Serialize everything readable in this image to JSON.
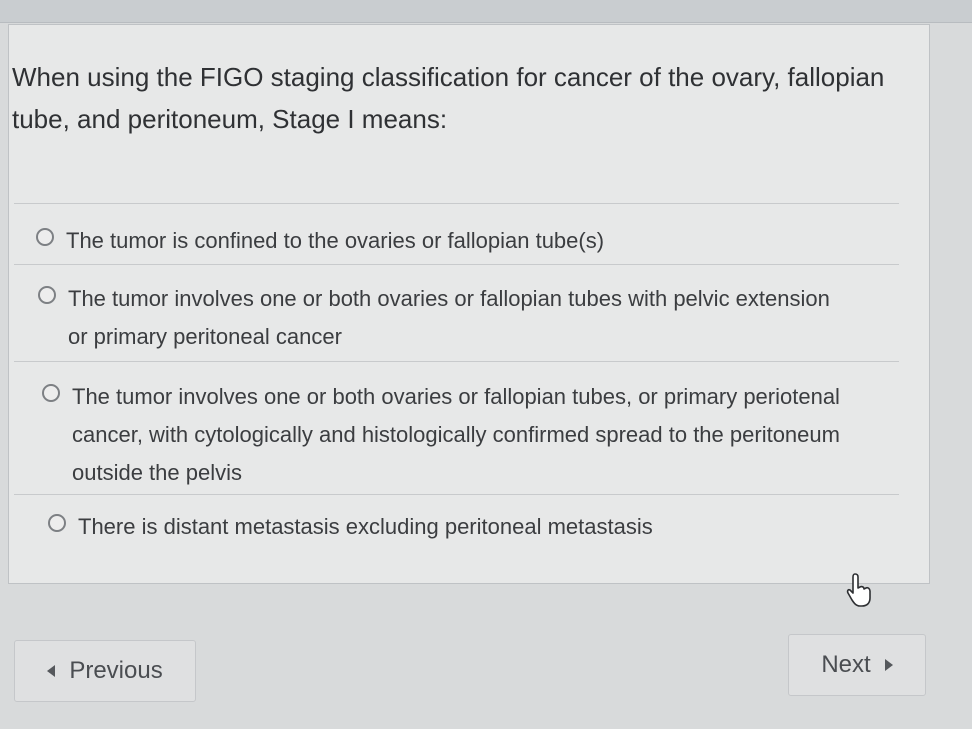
{
  "question": {
    "text": "When using the FIGO staging classification for cancer of the ovary, fallopian tube, and peritoneum, Stage I means:"
  },
  "answers": [
    {
      "label": "The tumor is confined to the ovaries or fallopian tube(s)",
      "selected": false
    },
    {
      "label": "The tumor involves one or both ovaries or fallopian tubes with pelvic extension or primary peritoneal cancer",
      "selected": false
    },
    {
      "label": "The tumor involves one or both ovaries or fallopian tubes, or primary periotenal cancer, with cytologically and histologically confirmed spread to the peritoneum outside the pelvis",
      "selected": false
    },
    {
      "label": "There is distant metastasis excluding peritoneal metastasis",
      "selected": false
    }
  ],
  "navigation": {
    "previous_label": "Previous",
    "next_label": "Next"
  },
  "icons": {
    "previous": "caret-left-icon",
    "next": "caret-right-icon",
    "pointer": "mouse-pointer-icon",
    "radio": "radio-unchecked-icon"
  },
  "colors": {
    "background": "#d8dadb",
    "card": "#e7e8e8",
    "text": "#3b3d40"
  }
}
